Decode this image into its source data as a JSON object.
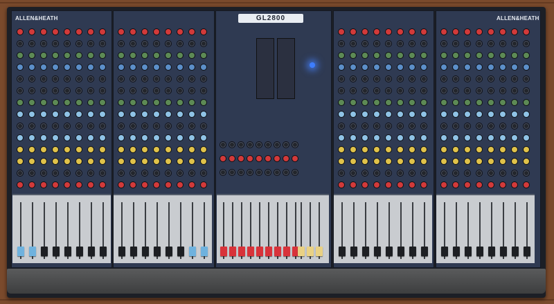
{
  "console": {
    "brand_left": "ALLEN&HEATH",
    "brand_right": "ALLEN&HEATH",
    "model": "GL2800"
  },
  "colors": {
    "panel": "#2f3a52",
    "fader_bay": "#c9ccd0",
    "wood": "#7a4a2c",
    "led": "#3d7dff"
  }
}
